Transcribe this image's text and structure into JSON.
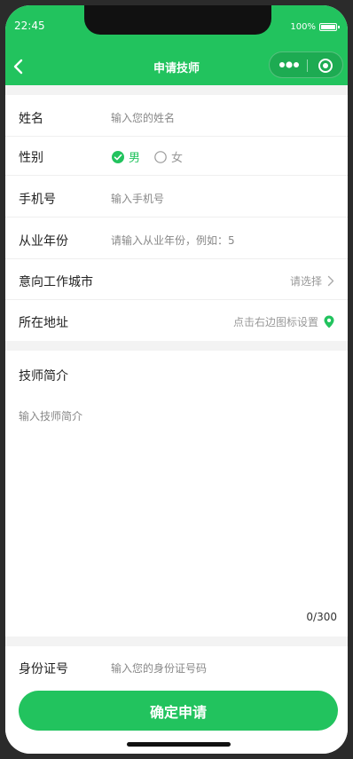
{
  "status": {
    "time": "22:45",
    "battery": "100%"
  },
  "nav": {
    "title": "申请技师"
  },
  "form": {
    "name": {
      "label": "姓名",
      "placeholder": "输入您的姓名"
    },
    "gender": {
      "label": "性别",
      "options": [
        "男",
        "女"
      ],
      "selected": "男"
    },
    "phone": {
      "label": "手机号",
      "placeholder": "输入手机号"
    },
    "years": {
      "label": "从业年份",
      "placeholder": "请输入从业年份，例如：5"
    },
    "city": {
      "label": "意向工作城市",
      "placeholder": "请选择"
    },
    "address": {
      "label": "所在地址",
      "placeholder": "点击右边图标设置"
    },
    "intro": {
      "label": "技师简介",
      "placeholder": "输入技师简介",
      "counter": "0/300"
    },
    "id_card": {
      "label": "身份证号",
      "placeholder": "输入您的身份证号码"
    }
  },
  "submit_label": "确定申请",
  "colors": {
    "accent": "#22c35e"
  },
  "icons": [
    "back-icon",
    "more-dots-icon",
    "target-icon",
    "check-circle-icon",
    "circle-icon",
    "chevron-right-icon",
    "location-pin-icon"
  ]
}
